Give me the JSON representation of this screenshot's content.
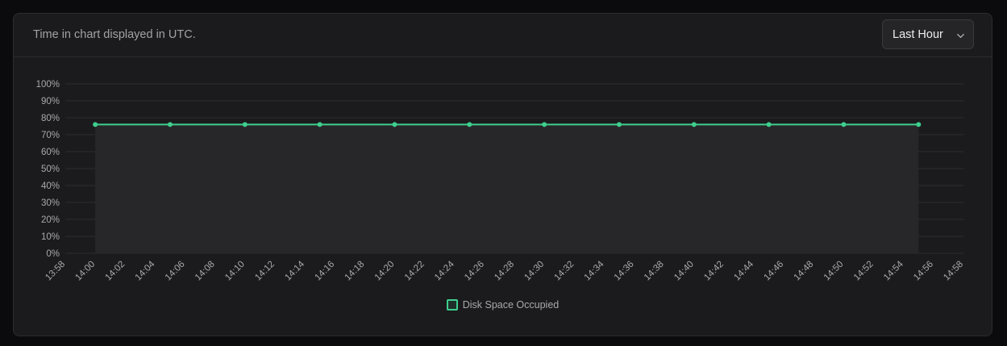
{
  "header": {
    "note": "Time in chart displayed in UTC.",
    "range_label": "Last Hour"
  },
  "icons": {
    "range_chevron": "chevron-down-icon"
  },
  "colors": {
    "series": "#3ecf8e",
    "area_fill": "#27272a",
    "grid": "#2c2c2f",
    "tick_text": "#a9a9ad"
  },
  "chart_data": {
    "type": "area",
    "title": "",
    "xlabel": "",
    "ylabel": "",
    "ylim": [
      0,
      100
    ],
    "y_unit": "%",
    "y_ticks": [
      0,
      10,
      20,
      30,
      40,
      50,
      60,
      70,
      80,
      90,
      100
    ],
    "x_tick_labels": [
      "13:58",
      "14:00",
      "14:02",
      "14:04",
      "14:06",
      "14:08",
      "14:10",
      "14:12",
      "14:14",
      "14:16",
      "14:18",
      "14:20",
      "14:22",
      "14:24",
      "14:26",
      "14:28",
      "14:30",
      "14:32",
      "14:34",
      "14:36",
      "14:38",
      "14:40",
      "14:42",
      "14:44",
      "14:46",
      "14:48",
      "14:50",
      "14:52",
      "14:54",
      "14:56",
      "14:58"
    ],
    "x": [
      "14:00",
      "14:05",
      "14:10",
      "14:15",
      "14:20",
      "14:25",
      "14:30",
      "14:35",
      "14:40",
      "14:45",
      "14:50",
      "14:55"
    ],
    "series": [
      {
        "name": "Disk Space Occupied",
        "values": [
          76,
          76,
          76,
          76,
          76,
          76,
          76,
          76,
          76,
          76,
          76,
          76
        ]
      }
    ],
    "grid": true,
    "legend_position": "bottom-center"
  }
}
